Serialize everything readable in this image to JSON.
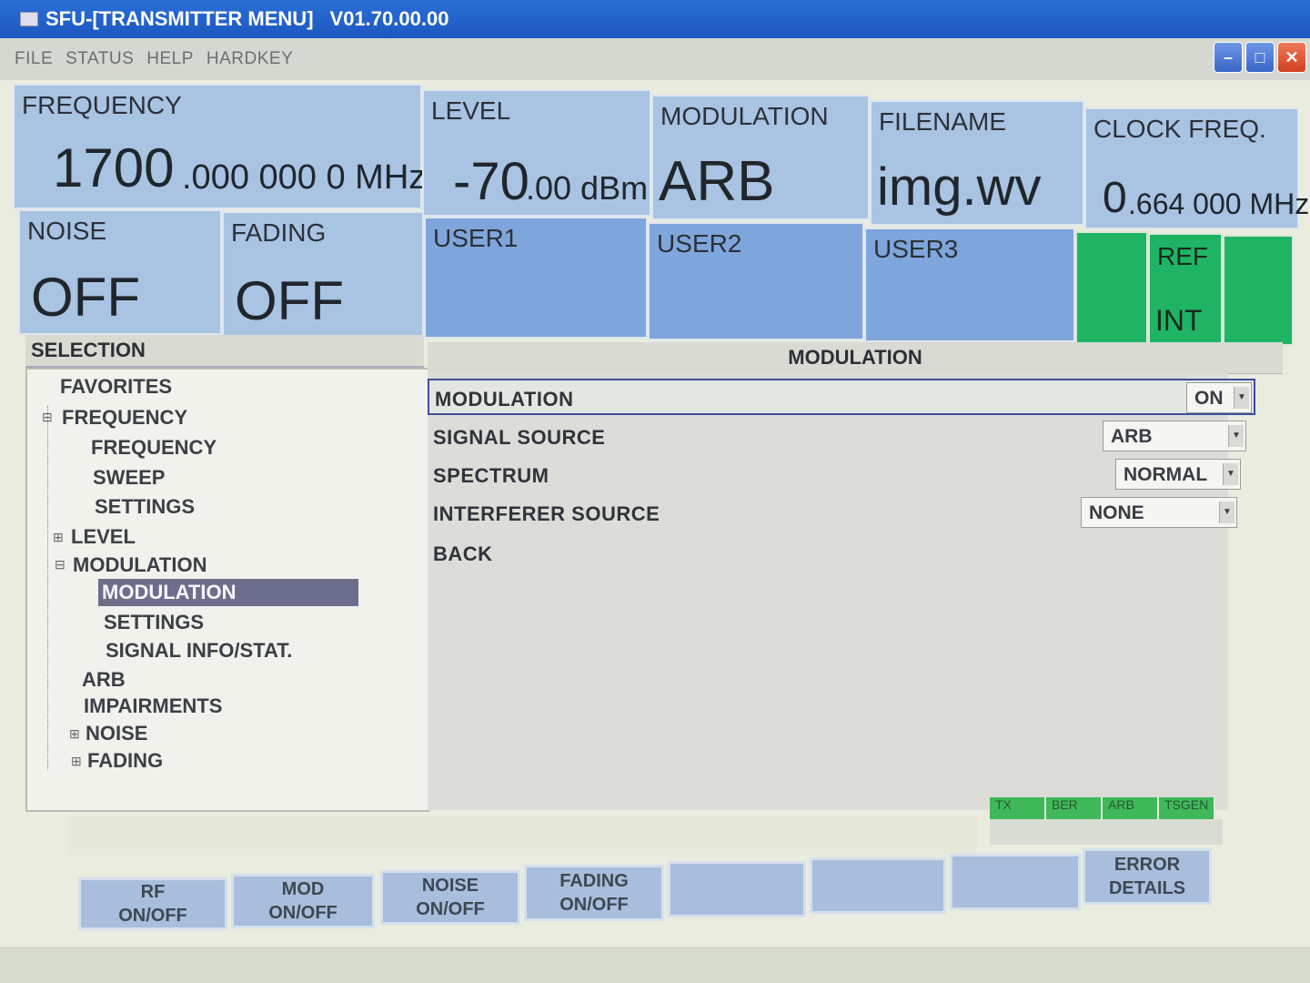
{
  "window": {
    "title": "SFU-[TRANSMITTER MENU]",
    "version": "V01.70.00.00"
  },
  "menu": [
    "FILE",
    "STATUS",
    "HELP",
    "HARDKEY"
  ],
  "status": {
    "frequency": {
      "label": "FREQUENCY",
      "big": "1700",
      "small": ".000 000 0 MHz"
    },
    "level": {
      "label": "LEVEL",
      "big": "-70",
      "small": ".00 dBm"
    },
    "modulation": {
      "label": "MODULATION",
      "value": "ARB"
    },
    "filename": {
      "label": "FILENAME",
      "value": "img.wv"
    },
    "clock": {
      "label": "CLOCK FREQ.",
      "big": "0",
      "small": ".664 000 MHz"
    },
    "noise": {
      "label": "NOISE",
      "value": "OFF"
    },
    "fading": {
      "label": "FADING",
      "value": "OFF"
    },
    "user1": "USER1",
    "user2": "USER2",
    "user3": "USER3",
    "ref": {
      "label": "REF",
      "value": "INT"
    }
  },
  "selection": {
    "header": "SELECTION",
    "items": [
      "FAVORITES",
      "FREQUENCY",
      "FREQUENCY",
      "SWEEP",
      "SETTINGS",
      "LEVEL",
      "MODULATION",
      "MODULATION",
      "SETTINGS",
      "SIGNAL INFO/STAT.",
      "ARB",
      "IMPAIRMENTS",
      "NOISE",
      "FADING"
    ]
  },
  "content": {
    "header": "MODULATION",
    "params": [
      {
        "label": "MODULATION",
        "value": "ON"
      },
      {
        "label": "SIGNAL SOURCE",
        "value": "ARB"
      },
      {
        "label": "SPECTRUM",
        "value": "NORMAL"
      },
      {
        "label": "INTERFERER SOURCE",
        "value": "NONE"
      },
      {
        "label": "BACK"
      }
    ]
  },
  "indicators": [
    "TX",
    "BER",
    "ARB",
    "TSGEN"
  ],
  "softkeys": [
    "RF\nON/OFF",
    "MOD\nON/OFF",
    "NOISE\nON/OFF",
    "FADING\nON/OFF",
    "",
    "",
    "",
    "ERROR\nDETAILS"
  ],
  "colors": {
    "panel": "#a9c3e2",
    "user_panel": "#7fa6dc",
    "ref_green": "#1fb464",
    "titlebar": "#1d57c0",
    "selected": "#6c6e8c"
  }
}
